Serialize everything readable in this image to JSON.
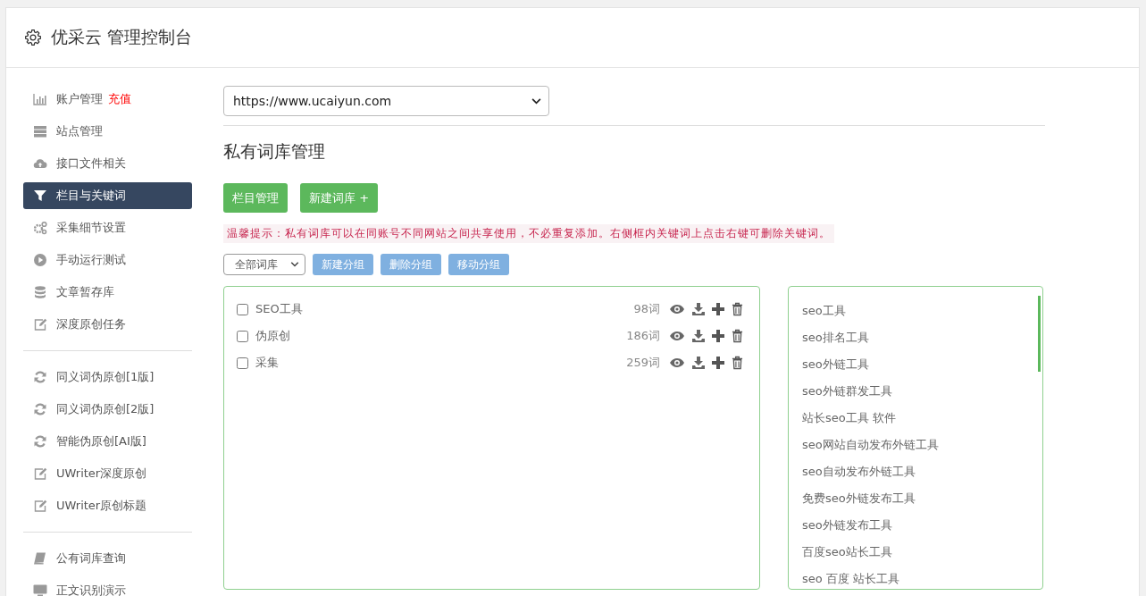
{
  "header": {
    "title": "优采云 管理控制台"
  },
  "sidebar": {
    "groups": [
      {
        "items": [
          {
            "label": "账户管理",
            "badge": "充值",
            "kind": "chart",
            "selected": false
          },
          {
            "label": "站点管理",
            "kind": "server",
            "selected": false
          },
          {
            "label": "接口文件相关",
            "kind": "cloud",
            "selected": false
          },
          {
            "label": "栏目与关键词",
            "kind": "filter",
            "selected": true
          },
          {
            "label": "采集细节设置",
            "kind": "gears",
            "selected": false
          },
          {
            "label": "手动运行测试",
            "kind": "play",
            "selected": false
          },
          {
            "label": "文章暂存库",
            "kind": "database",
            "selected": false
          },
          {
            "label": "深度原创任务",
            "kind": "edit",
            "selected": false
          }
        ]
      },
      {
        "items": [
          {
            "label": "同义词伪原创[1版]",
            "kind": "refresh",
            "selected": false
          },
          {
            "label": "同义词伪原创[2版]",
            "kind": "refresh",
            "selected": false
          },
          {
            "label": "智能伪原创[AI版]",
            "kind": "refresh",
            "selected": false
          },
          {
            "label": "UWriter深度原创",
            "kind": "edit",
            "selected": false
          },
          {
            "label": "UWriter原创标题",
            "kind": "edit",
            "selected": false
          }
        ]
      },
      {
        "items": [
          {
            "label": "公有词库查询",
            "kind": "book",
            "selected": false
          },
          {
            "label": "正文识别演示",
            "kind": "monitor",
            "selected": false
          }
        ]
      }
    ]
  },
  "site_select": {
    "value": "https://www.ucaiyun.com"
  },
  "page_title": "私有词库管理",
  "primary_buttons": [
    "栏目管理",
    "新建词库 +"
  ],
  "hint": "温馨提示：私有词库可以在同账号不同网站之间共享使用，不必重复添加。右侧框内关键词上点击右键可删除关键词。",
  "group_select": {
    "value": "全部词库"
  },
  "group_buttons": [
    "新建分组",
    "删除分组",
    "移动分组"
  ],
  "libraries": [
    {
      "name": "SEO工具",
      "count": "98词",
      "checked": false
    },
    {
      "name": "伪原创",
      "count": "186词",
      "checked": false
    },
    {
      "name": "采集",
      "count": "259词",
      "checked": false
    }
  ],
  "keywords": [
    "seo工具",
    "seo排名工具",
    "seo外链工具",
    "seo外链群发工具",
    "站长seo工具 软件",
    "seo网站自动发布外链工具",
    "seo自动发布外链工具",
    "免费seo外链发布工具",
    "seo外链发布工具",
    "百度seo站长工具",
    "seo 百度 站长工具"
  ]
}
